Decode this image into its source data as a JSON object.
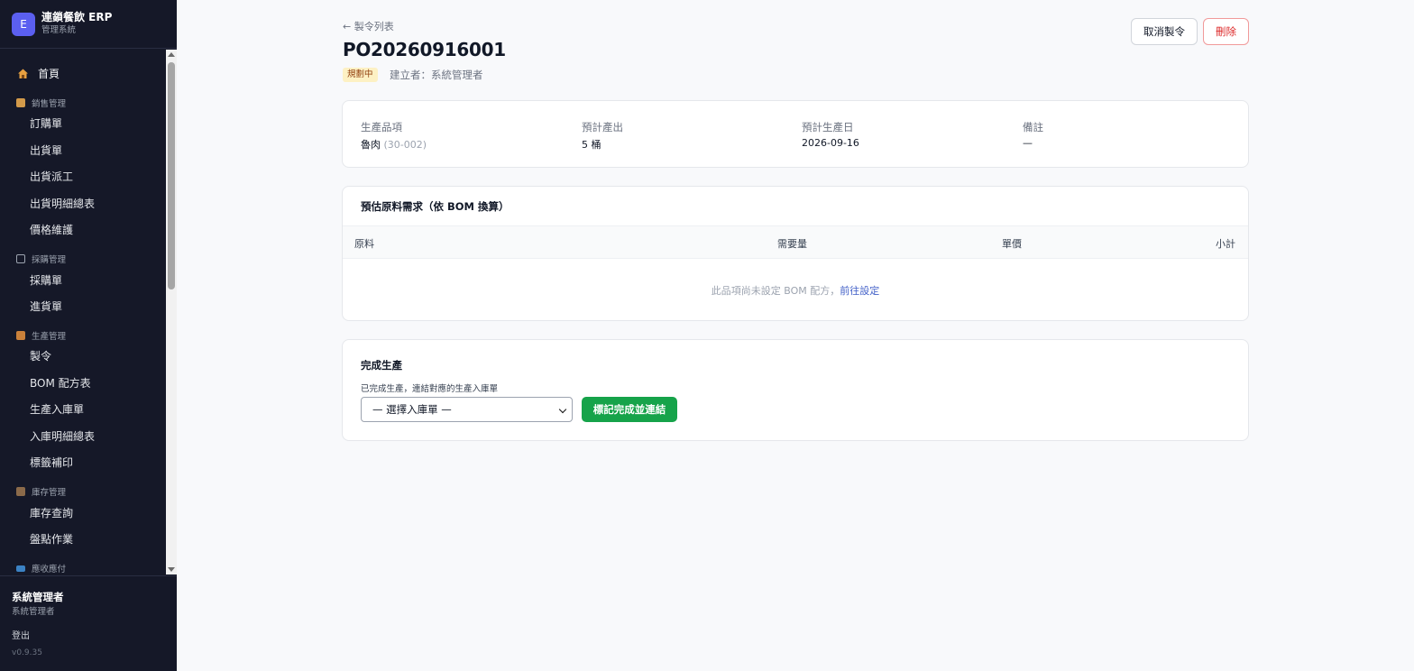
{
  "app": {
    "logo_letter": "E",
    "title": "連鎖餐飲 ERP",
    "subtitle": "管理系統"
  },
  "sidebar": {
    "home": "首頁",
    "groups": {
      "sales": "銷售管理",
      "purchase": "採購管理",
      "production": "生產管理",
      "inventory": "庫存管理",
      "finance": "應收應付"
    },
    "items": {
      "order": "訂購單",
      "shipment": "出貨單",
      "dispatch": "出貨派工",
      "shipment_summary": "出貨明細總表",
      "pricing": "價格維護",
      "purchase_order": "採購單",
      "receiving": "進貨單",
      "work_order": "製令",
      "bom": "BOM 配方表",
      "production_in": "生產入庫單",
      "in_summary": "入庫明細總表",
      "label_reprint": "標籤補印",
      "stock_query": "庫存查詢",
      "stocktake": "盤點作業"
    },
    "user": {
      "name": "系統管理者",
      "role": "系統管理者"
    },
    "logout": "登出",
    "version": "v0.9.35"
  },
  "header": {
    "back": "← 製令列表",
    "title": "PO20260916001",
    "status": "規劃中",
    "creator": "建立者：系統管理者",
    "cancel_button": "取消製令",
    "delete_button": "刪除"
  },
  "info": {
    "product_label": "生產品項",
    "product_name": "魯肉",
    "product_code": "(30-002)",
    "qty_label": "預計產出",
    "qty_value": "5 桶",
    "date_label": "預計生產日",
    "date_value": "2026-09-16",
    "note_label": "備註",
    "note_value": "—"
  },
  "bom": {
    "title": "預估原料需求（依 BOM 換算）",
    "columns": {
      "material": "原料",
      "required": "需要量",
      "unit_price": "單價",
      "subtotal": "小計"
    },
    "empty_text": "此品項尚未設定 BOM 配方，",
    "empty_link": "前往設定"
  },
  "complete": {
    "title": "完成生產",
    "hint": "已完成生產，連結對應的生產入庫單",
    "select_value": "— 選擇入庫單 —",
    "button": "標記完成並連結"
  },
  "colors": {
    "sidebar_bg": "#151828",
    "accent": "#5b5ff0",
    "success": "#16a34a",
    "danger": "#dc2626",
    "status_bg": "#fdf1c4"
  }
}
